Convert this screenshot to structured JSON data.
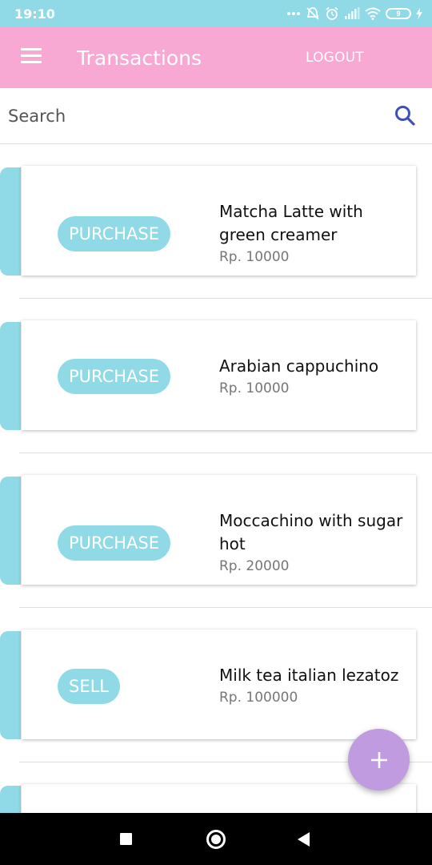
{
  "status_bar": {
    "time": "19:10",
    "battery": "9",
    "icons": [
      "dots-icon",
      "bell-off-icon",
      "alarm-icon",
      "signal-icon",
      "wifi-icon",
      "battery-icon",
      "charging-icon"
    ]
  },
  "app_bar": {
    "title": "Transactions",
    "logout_label": "LOGOUT"
  },
  "search": {
    "placeholder": "Search"
  },
  "transactions": [
    {
      "type": "PURCHASE",
      "name": "Matcha Latte with green creamer",
      "price": "Rp. 10000"
    },
    {
      "type": "PURCHASE",
      "name": "Arabian cappuchino",
      "price": "Rp. 10000"
    },
    {
      "type": "PURCHASE",
      "name": "Moccachino with sugar hot",
      "price": "Rp. 20000"
    },
    {
      "type": "SELL",
      "name": "Milk tea italian lezatoz",
      "price": "Rp. 100000"
    }
  ],
  "colors": {
    "status_bar": "#8fdae6",
    "app_bar": "#f7a8d3",
    "accent": "#8fdae6",
    "fab": "#c09be0",
    "search_icon": "#3f51b5"
  },
  "fab": {
    "icon": "plus-icon"
  }
}
